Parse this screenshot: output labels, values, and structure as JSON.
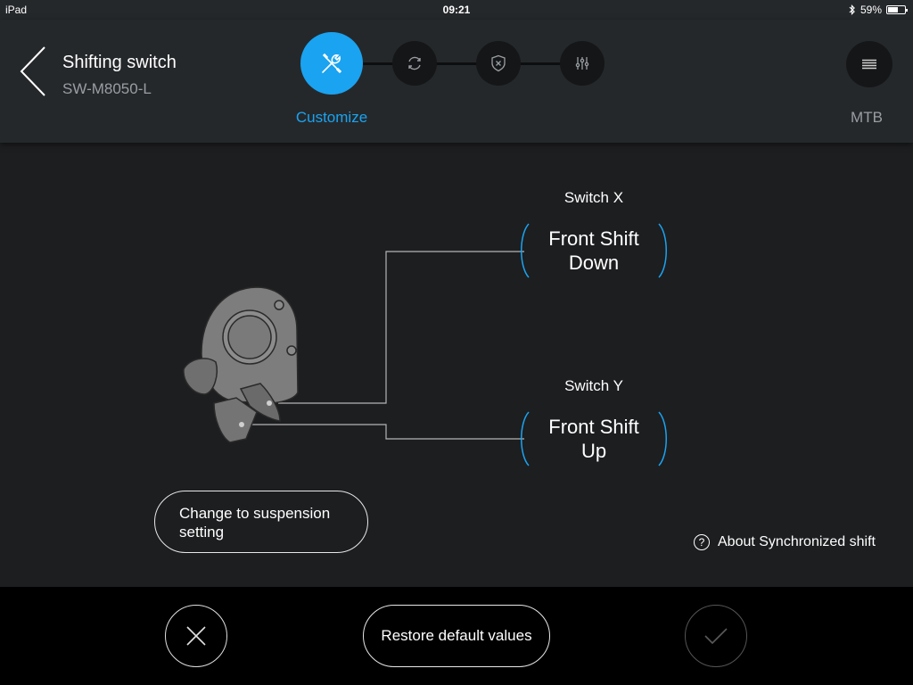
{
  "status_bar": {
    "device": "iPad",
    "time": "09:21",
    "battery": "59%",
    "battery_level": 0.59
  },
  "header": {
    "title": "Shifting switch",
    "subtitle": "SW-M8050-L",
    "active_step_label": "Customize",
    "mode": "MTB",
    "steps": [
      "customize-icon",
      "refresh-icon",
      "shield-icon",
      "sliders-icon"
    ]
  },
  "colors": {
    "accent": "#1aa3f0",
    "background": "#1d1e20",
    "header": "#25282b"
  },
  "switches": [
    {
      "name": "Switch X",
      "function_line1": "Front Shift",
      "function_line2": "Down"
    },
    {
      "name": "Switch Y",
      "function_line1": "Front Shift",
      "function_line2": "Up"
    }
  ],
  "buttons": {
    "change_mode": "Change to suspension setting",
    "about": "About Synchronized shift",
    "restore": "Restore default values"
  }
}
